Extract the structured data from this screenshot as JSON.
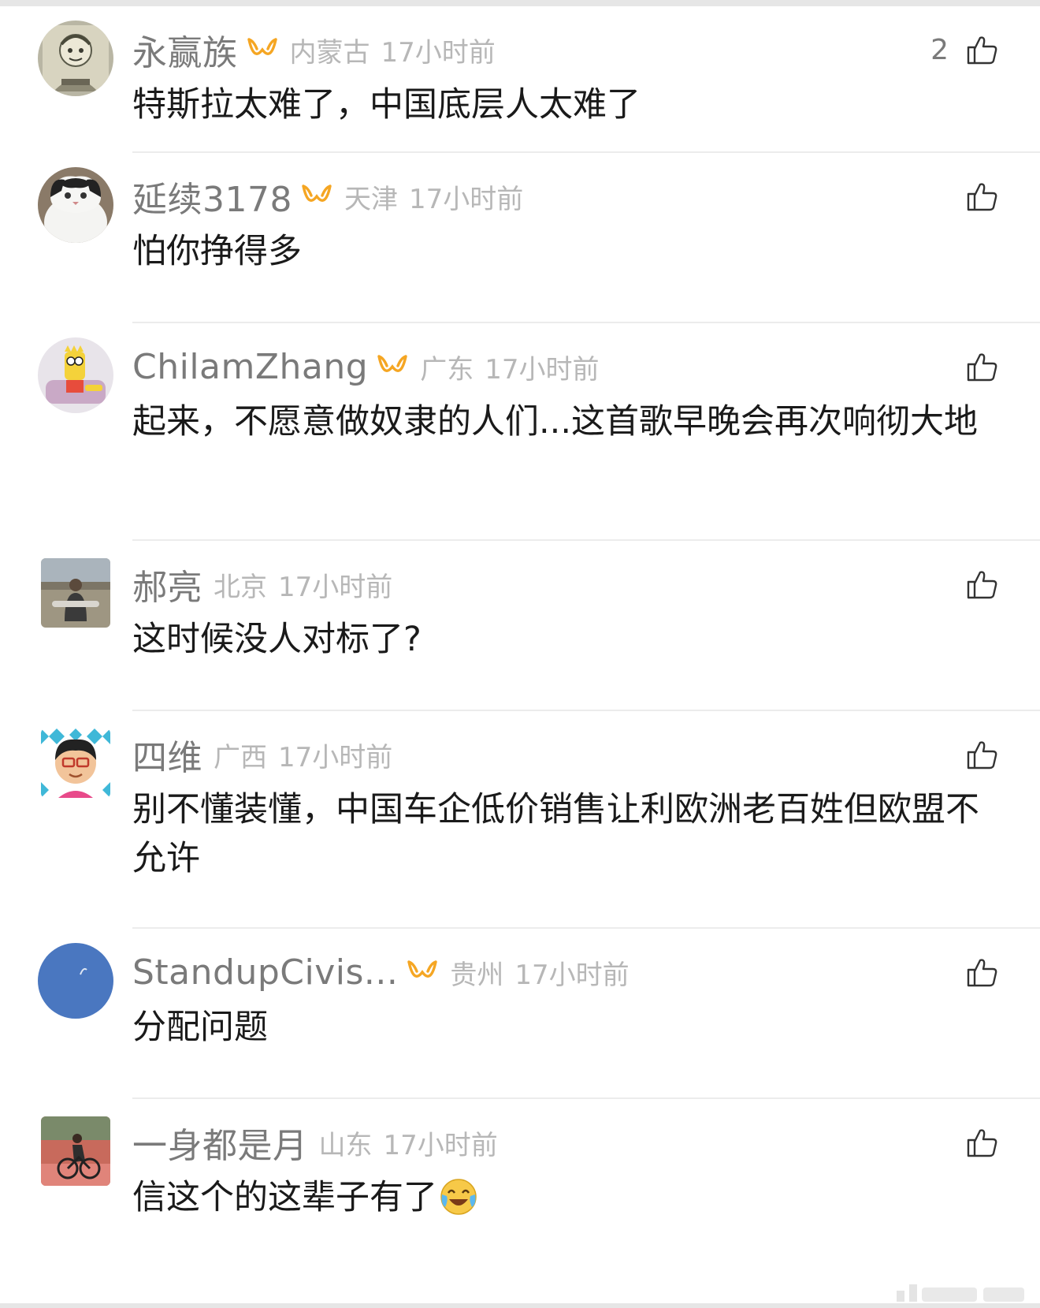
{
  "comments": [
    {
      "username": "永赢族",
      "location": "内蒙古",
      "time": "17小时前",
      "text": "特斯拉太难了，中国底层人太难了",
      "likes": "2",
      "avatar": "sketch-portrait-avatar",
      "vip": true
    },
    {
      "username": "延续3178",
      "location": "天津",
      "time": "17小时前",
      "text": "怕你挣得多",
      "likes": "",
      "avatar": "cat-avatar",
      "vip": true
    },
    {
      "username": "ChilamZhang",
      "location": "广东",
      "time": "17小时前",
      "text": "起来，不愿意做奴隶的人们...这首歌早晚会再次响彻大地",
      "likes": "",
      "avatar": "cartoon-avatar",
      "vip": true
    },
    {
      "username": "郝亮",
      "location": "北京",
      "time": "17小时前",
      "text": "这时候没人对标了?",
      "likes": "",
      "avatar": "outdoor-photo-avatar",
      "vip": false
    },
    {
      "username": "四维",
      "location": "广西",
      "time": "17小时前",
      "text": "别不懂装懂，中国车企低价销售让利欧洲老百姓但欧盟不允许",
      "likes": "",
      "avatar": "cartoon-glasses-avatar",
      "vip": false
    },
    {
      "username": "StandupCivis...",
      "location": "贵州",
      "time": "17小时前",
      "text": "分配问题",
      "likes": "",
      "avatar": "blue-circle-avatar",
      "vip": true
    },
    {
      "username": "一身都是月",
      "location": "山东",
      "time": "17小时前",
      "text": "信这个的这辈子有了",
      "likes": "",
      "avatar": "cyclist-photo-avatar",
      "vip": false,
      "emoji": "crying-laughing-emoji"
    }
  ],
  "colors": {
    "username": "#7a7a7a",
    "meta": "#b7b7b7",
    "text": "#1a1a1a",
    "vip": "#f5a623",
    "divider": "#ececec"
  }
}
